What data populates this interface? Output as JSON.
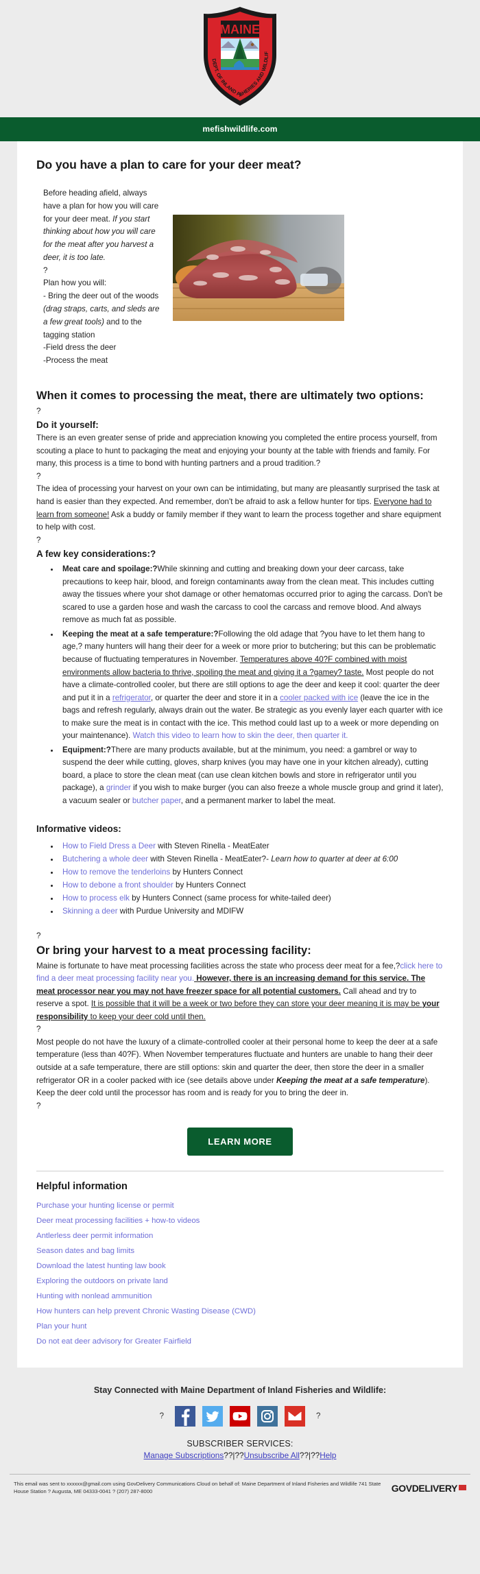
{
  "header": {
    "seal_alt": "Maine Department of Inland Fisheries and Wildlife seal",
    "seal_word_top": "MAINE",
    "seal_word_arc": "DEPT. OF INLAND FISHERIES AND WILDLIFE",
    "website": "mefishwildlife.com"
  },
  "main": {
    "title": "Do you have a plan to care for your deer meat?",
    "intro": {
      "p1_plain": "Before heading afield, always have a plan for how you will care for your deer meat. ",
      "p1_italic": "If you start thinking about how you will care for the meat after you harvest a deer, it is too late.",
      "q1": "?",
      "plan_label": "Plan how you will:",
      "bullet1_a": "- Bring the deer out of the woods ",
      "bullet1_italic": "(drag straps, carts, and sleds are a few great tools)",
      "bullet1_b": " and to the tagging station",
      "bullet2": "-Field dress the deer",
      "bullet3": "-Process the meat"
    },
    "section_two_options": "When it comes to processing the meat, there are ultimately two options:",
    "q_after_options": "?",
    "diy_heading": "Do it yourself:",
    "diy_p1": "There is an even greater sense of pride and appreciation knowing you completed the entire process yourself, from scouting a place to hunt to packaging the meat and enjoying your bounty at the table with friends and family. For many, this process is a time to bond with hunting partners and a proud tradition.?",
    "q_mid1": "?",
    "diy_p2_a": "The idea of processing your harvest on your own can be intimidating, but many are pleasantly surprised the task at hand is easier than they expected. And remember, don't be afraid to ask a fellow hunter for tips. ",
    "diy_p2_underline": "Everyone had to learn from someone!",
    "diy_p2_b": " Ask a buddy or family member if they want to learn the process together and share equipment to help with cost.",
    "q_mid2": "?",
    "considerations_heading": "A few key considerations:?",
    "bullets": [
      {
        "label": "Meat care and spoilage:?",
        "text": "While skinning and cutting and breaking down your deer carcass, take precautions to keep hair, blood, and foreign contaminants away from the clean meat. This includes cutting away the tissues where your shot damage or other hematomas occurred prior to aging the carcass. Don't be scared to use a garden hose and wash the carcass to cool the carcass and remove blood. And always remove as much fat as possible."
      },
      {
        "label": "Keeping the meat at a safe temperature:?",
        "part1": "Following the old adage that ?you have to let them hang to age,? many hunters will hang their deer for a week or more prior to butchering; but this can be problematic because of fluctuating temperatures in November. ",
        "underline1": "Temperatures above 40?F combined with moist environments allow bacteria to thrive, spoiling the meat and giving it a ?gamey? taste.",
        "part2": " Most people do not have a climate-controlled cooler, but there are still options to age the deer and keep it cool: quarter the deer and put it in a ",
        "link_refrigerator": "refrigerator",
        "part3": ", or quarter the deer and store it in a ",
        "link_cooler": "cooler packed with ice",
        "part4": " (leave the ice in the bags and refresh regularly, always drain out the water. Be strategic as you evenly layer each quarter with ice to make sure the meat is in contact with the ice. This method could last up to a week or more depending on your maintenance). ",
        "link_video": "Watch this video to learn how to skin the deer, then quarter it."
      },
      {
        "label": "Equipment:?",
        "part1": "There are many products available, but at the minimum, you need: a gambrel or way to suspend the deer while cutting, gloves, sharp knives (you may have one in your kitchen already), cutting board, a place to store the clean meat (can use clean kitchen bowls and store in refrigerator until you package), a ",
        "link_grinder": "grinder",
        "part2": " if you wish to make burger (you can also freeze a whole muscle group and grind it later), a vacuum sealer or ",
        "link_butcher_paper": "butcher paper",
        "part3": ", and a permanent marker to label the meat."
      }
    ],
    "videos_heading": "Informative videos:",
    "videos": [
      {
        "link": "How to Field Dress a Deer",
        "after": " with Steven Rinella - MeatEater",
        "italic": ""
      },
      {
        "link": "Butchering a whole deer",
        "after": " with Steven Rinella - MeatEater?- ",
        "italic": "Learn how to quarter at deer at 6:00"
      },
      {
        "link": "How to remove the tenderloins",
        "after": " by Hunters Connect",
        "italic": ""
      },
      {
        "link": "How to debone a front shoulder",
        "after": " by Hunters Connect",
        "italic": ""
      },
      {
        "link": "How to process elk",
        "after": " by Hunters Connect (same process for white-tailed deer)",
        "italic": ""
      },
      {
        "link": "Skinning a deer",
        "after": " with Purdue University and MDIFW",
        "italic": ""
      }
    ],
    "q_before_facility": "?",
    "facility_heading": "Or bring your harvest to a meat processing facility:",
    "facility_p1_a": "Maine is fortunate to have meat processing facilities across the state who process deer meat for a fee,?",
    "facility_link": "click here to find a deer meat processing facility near you.",
    "facility_p1_bold_u1": " However, there is an increasing demand for this service. The meat processor near you may not have freezer space for all potential customers.",
    "facility_p1_b": " Call ahead and try to reserve a spot. ",
    "facility_p1_u2": "It is possible that it will be a week or two before they can store your deer meaning it is may be ",
    "facility_p1_bu": "your responsibility",
    "facility_p1_u3": " to keep your deer cold until then.",
    "q_mid3": "?",
    "facility_p2_a": "Most people do not have the luxury of a climate-controlled cooler at their personal home to keep the deer at a safe temperature (less than 40?F). When November temperatures fluctuate and hunters are unable to hang their deer outside at a safe temperature, there are still options: skin and quarter the deer, then store the deer in a smaller refrigerator OR in a cooler packed with ice (see details above under ",
    "facility_p2_bi": "Keeping the meat at a safe temperature",
    "facility_p2_b": "). Keep the deer cold until the processor has room and is ready for you to bring the deer in.",
    "q_end": "?",
    "cta_label": "LEARN MORE",
    "helpful_heading": "Helpful information",
    "helpful_links": [
      "Purchase your hunting license or permit",
      "Deer meat processing facilities + how-to videos",
      "Antlerless deer permit information",
      "Season dates and bag limits",
      "Download the latest hunting law book",
      "Exploring the outdoors on private land",
      "Hunting with nonlead ammunition",
      "How hunters can help prevent Chronic Wasting Disease (CWD)",
      "Plan your hunt",
      "Do not eat deer advisory for Greater Fairfield"
    ]
  },
  "footer": {
    "stay_connected": "Stay Connected with Maine Department of Inland Fisheries and Wildlife:",
    "q_left": "?",
    "q_right": "?",
    "social": [
      {
        "name": "facebook-icon",
        "color": "#3b5998"
      },
      {
        "name": "twitter-icon",
        "color": "#1da1f2"
      },
      {
        "name": "youtube-icon",
        "color": "#cc0000"
      },
      {
        "name": "instagram-icon",
        "color": "#3f729b"
      },
      {
        "name": "email-icon",
        "color": "#d93025"
      }
    ],
    "subscriber_services": "SUBSCRIBER SERVICES:",
    "manage_subscriptions": "Manage Subscriptions",
    "sep1": "??|??",
    "unsubscribe": "Unsubscribe All",
    "sep2": "??|??",
    "help": "Help",
    "legal": "This email was sent to xxxxxx@gmail.com using GovDelivery Communications Cloud on behalf of: Maine Department of Inland Fisheries and Wildlife 741 State House Station ? Augusta, ME 04333-0041 ? (207) 287-8000",
    "govdelivery": "GOVDELIVERY"
  },
  "colors": {
    "brand_green": "#0a5c2e",
    "link_purple": "#6f6fd8",
    "page_bg": "#ececec",
    "seal_red": "#d8232a"
  }
}
